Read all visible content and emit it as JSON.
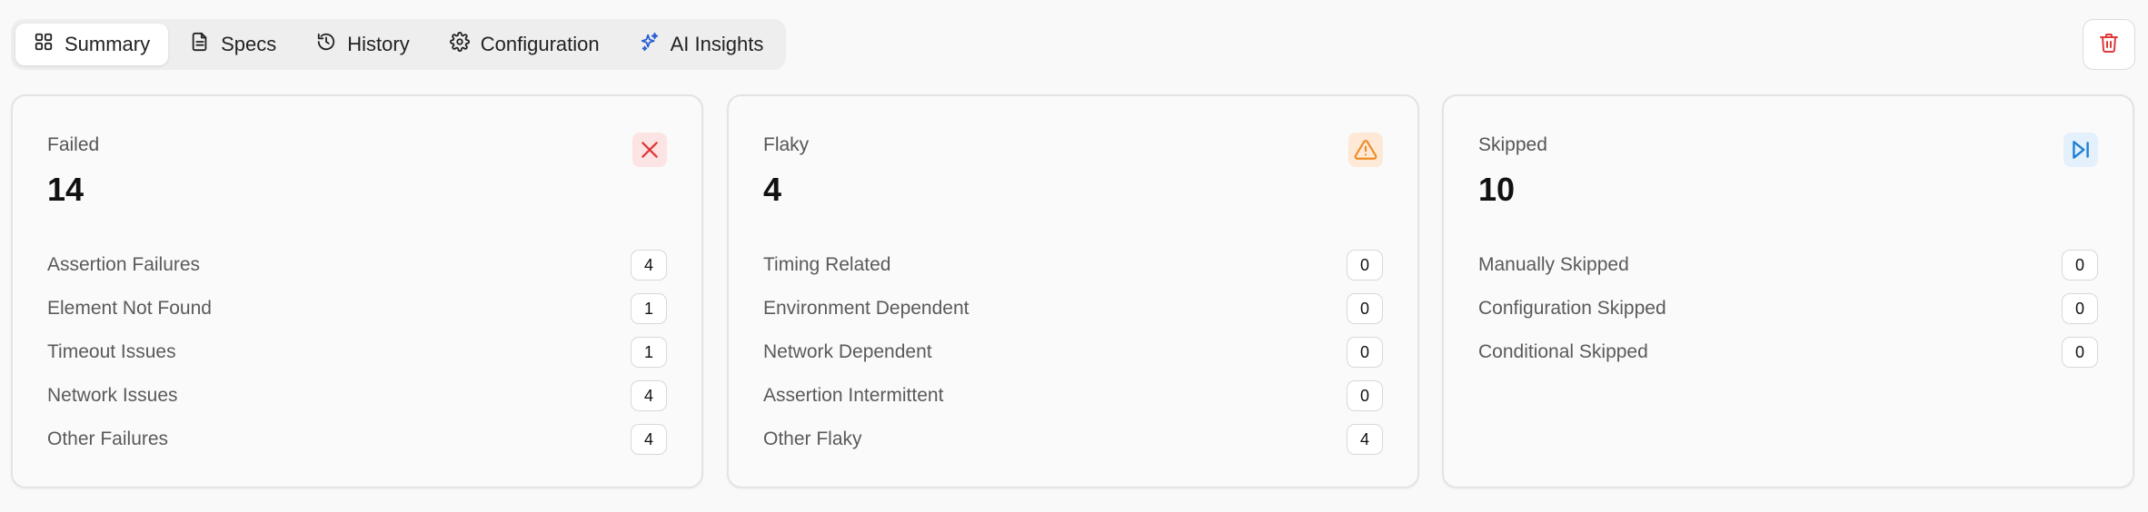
{
  "tabs": [
    {
      "label": "Summary",
      "icon": "grid-icon",
      "active": true
    },
    {
      "label": "Specs",
      "icon": "document-icon",
      "active": false
    },
    {
      "label": "History",
      "icon": "history-icon",
      "active": false
    },
    {
      "label": "Configuration",
      "icon": "gear-icon",
      "active": false
    },
    {
      "label": "AI Insights",
      "icon": "sparkles-icon",
      "active": false
    }
  ],
  "delete_button": {
    "icon": "trash-icon",
    "color": "#e03a3a"
  },
  "cards": [
    {
      "title": "Failed",
      "count": "14",
      "icon": "close-icon",
      "accent": "#e03a3a",
      "rows": [
        {
          "label": "Assertion Failures",
          "value": "4"
        },
        {
          "label": "Element Not Found",
          "value": "1"
        },
        {
          "label": "Timeout Issues",
          "value": "1"
        },
        {
          "label": "Network Issues",
          "value": "4"
        },
        {
          "label": "Other Failures",
          "value": "4"
        }
      ]
    },
    {
      "title": "Flaky",
      "count": "4",
      "icon": "warning-icon",
      "accent": "#f08a24",
      "rows": [
        {
          "label": "Timing Related",
          "value": "0"
        },
        {
          "label": "Environment Dependent",
          "value": "0"
        },
        {
          "label": "Network Dependent",
          "value": "0"
        },
        {
          "label": "Assertion Intermittent",
          "value": "0"
        },
        {
          "label": "Other Flaky",
          "value": "4"
        }
      ]
    },
    {
      "title": "Skipped",
      "count": "10",
      "icon": "skip-forward-icon",
      "accent": "#1e7fd6",
      "rows": [
        {
          "label": "Manually Skipped",
          "value": "0"
        },
        {
          "label": "Configuration Skipped",
          "value": "0"
        },
        {
          "label": "Conditional Skipped",
          "value": "0"
        }
      ]
    }
  ]
}
